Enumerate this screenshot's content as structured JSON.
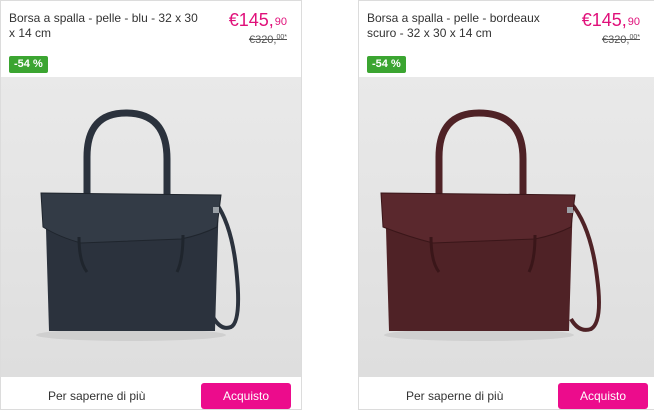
{
  "products": [
    {
      "title": "Borsa a spalla - pelle - blu - 32 x 30 x 14 cm",
      "price_main": "€145,",
      "price_cents": "90",
      "old_price_main": "€320,",
      "old_price_cents": "00*",
      "discount": "-54 %",
      "bag_color": "#2b323d",
      "more_label": "Per saperne di più",
      "buy_label": "Acquisto"
    },
    {
      "title": "Borsa a spalla - pelle - bordeaux scuro - 32 x 30 x 14 cm",
      "price_main": "€145,",
      "price_cents": "90",
      "old_price_main": "€320,",
      "old_price_cents": "00*",
      "discount": "-54 %",
      "bag_color": "#4f2226",
      "more_label": "Per saperne di più",
      "buy_label": "Acquisto"
    }
  ],
  "colors": {
    "price": "#e0107a",
    "badge": "#3ba531",
    "button": "#ec0c8c"
  }
}
